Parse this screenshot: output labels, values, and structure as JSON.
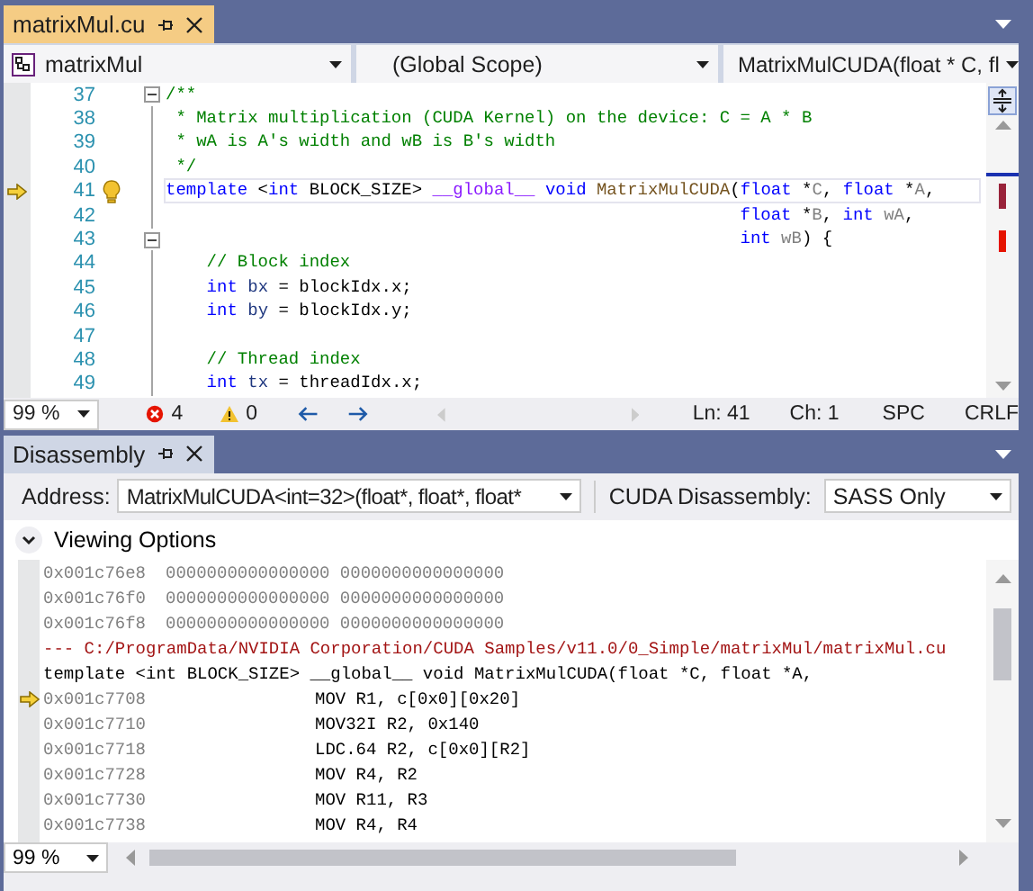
{
  "editor_tabs": [
    {
      "label": "matrixMul.cu",
      "selected": true
    }
  ],
  "navigation_bar": {
    "project": "matrixMul",
    "scope": "(Global Scope)",
    "member": "MatrixMulCUDA(float * C, fl"
  },
  "code_lines": [
    {
      "number": "37",
      "fold": true,
      "current": false,
      "lightbulb": false,
      "segments": [
        {
          "kind": "comment",
          "text": "/**"
        }
      ]
    },
    {
      "number": "38",
      "fold": false,
      "current": false,
      "lightbulb": false,
      "segments": [
        {
          "kind": "comment",
          "text": " * Matrix multiplication (CUDA Kernel) on the device: C = A * B"
        }
      ]
    },
    {
      "number": "39",
      "fold": false,
      "current": false,
      "lightbulb": false,
      "segments": [
        {
          "kind": "comment",
          "text": " * wA is A's width and wB is B's width"
        }
      ]
    },
    {
      "number": "40",
      "fold": false,
      "current": false,
      "lightbulb": false,
      "segments": [
        {
          "kind": "comment",
          "text": " */"
        }
      ]
    },
    {
      "number": "41",
      "fold": false,
      "current": true,
      "lightbulb": true,
      "segments": [
        {
          "kind": "keyword",
          "text": "template"
        },
        {
          "kind": "plain",
          "text": " <"
        },
        {
          "kind": "keyword",
          "text": "int"
        },
        {
          "kind": "plain",
          "text": " BLOCK_SIZE> "
        },
        {
          "kind": "macro",
          "text": "__global__"
        },
        {
          "kind": "keyword",
          "text": " void"
        },
        {
          "kind": "function",
          "text": " MatrixMulCUDA"
        },
        {
          "kind": "plain",
          "text": "("
        },
        {
          "kind": "keyword",
          "text": "float"
        },
        {
          "kind": "plain",
          "text": " *"
        },
        {
          "kind": "param",
          "text": "C"
        },
        {
          "kind": "plain",
          "text": ", "
        },
        {
          "kind": "keyword",
          "text": "float"
        },
        {
          "kind": "plain",
          "text": " *"
        },
        {
          "kind": "param",
          "text": "A"
        },
        {
          "kind": "plain",
          "text": ","
        }
      ]
    },
    {
      "number": "42",
      "fold": false,
      "current": false,
      "lightbulb": false,
      "segments": [
        {
          "kind": "keyword",
          "text": "                                                        float"
        },
        {
          "kind": "plain",
          "text": " *"
        },
        {
          "kind": "param",
          "text": "B"
        },
        {
          "kind": "plain",
          "text": ", "
        },
        {
          "kind": "keyword",
          "text": "int"
        },
        {
          "kind": "param",
          "text": " wA"
        },
        {
          "kind": "plain",
          "text": ","
        }
      ]
    },
    {
      "number": "43",
      "fold": true,
      "current": false,
      "lightbulb": false,
      "segments": [
        {
          "kind": "keyword",
          "text": "                                                        int"
        },
        {
          "kind": "param",
          "text": " wB"
        },
        {
          "kind": "plain",
          "text": ") {"
        }
      ]
    },
    {
      "number": "44",
      "fold": false,
      "current": false,
      "lightbulb": false,
      "segments": [
        {
          "kind": "comment",
          "text": "    // Block index"
        }
      ]
    },
    {
      "number": "45",
      "fold": false,
      "current": false,
      "lightbulb": false,
      "segments": [
        {
          "kind": "keyword",
          "text": "    int"
        },
        {
          "kind": "local",
          "text": " bx"
        },
        {
          "kind": "plain",
          "text": " = blockIdx.x;"
        }
      ]
    },
    {
      "number": "46",
      "fold": false,
      "current": false,
      "lightbulb": false,
      "segments": [
        {
          "kind": "keyword",
          "text": "    int"
        },
        {
          "kind": "local",
          "text": " by"
        },
        {
          "kind": "plain",
          "text": " = blockIdx.y;"
        }
      ]
    },
    {
      "number": "47",
      "fold": false,
      "current": false,
      "lightbulb": false
    },
    {
      "number": "48",
      "fold": false,
      "current": false,
      "lightbulb": false,
      "segments": [
        {
          "kind": "comment",
          "text": "    // Thread index"
        }
      ]
    },
    {
      "number": "49",
      "fold": false,
      "current": false,
      "lightbulb": false,
      "segments": [
        {
          "kind": "keyword",
          "text": "    int"
        },
        {
          "kind": "local",
          "text": " tx"
        },
        {
          "kind": "plain",
          "text": " = threadIdx.x;"
        }
      ]
    }
  ],
  "editor_status": {
    "zoom": "99 %",
    "errors": "4",
    "warnings": "0",
    "line": "Ln: 41",
    "column": "Ch: 1",
    "whitespace": "SPC",
    "line_endings": "CRLF"
  },
  "tool_tabs": [
    {
      "label": "Disassembly",
      "selected": false
    }
  ],
  "disassembly": {
    "address_label": "Address:",
    "address": "MatrixMulCUDA<int=32>(float*, float*, float*",
    "mode_label": "CUDA Disassembly:",
    "mode": "SASS Only",
    "viewing_options": "Viewing Options",
    "zoom": "99 %",
    "lines": [
      {
        "kind": "data",
        "current": false,
        "address": "0x001c76e8",
        "instruction": "0000000000000000 0000000000000000"
      },
      {
        "kind": "data",
        "current": false,
        "address": "0x001c76f0",
        "instruction": "0000000000000000 0000000000000000"
      },
      {
        "kind": "data",
        "current": false,
        "address": "0x001c76f8",
        "instruction": "0000000000000000 0000000000000000"
      },
      {
        "kind": "source",
        "current": false,
        "text": "--- C:/ProgramData/NVIDIA Corporation/CUDA Samples/v11.0/0_Simple/matrixMul/matrixMul.cu"
      },
      {
        "kind": "source_code",
        "current": false,
        "text": "template <int BLOCK_SIZE> __global__ void MatrixMulCUDA(float *C, float *A,"
      },
      {
        "kind": "code",
        "current": true,
        "address": "0x001c7708",
        "instruction": "MOV R1, c[0x0][0x20]"
      },
      {
        "kind": "code",
        "current": false,
        "address": "0x001c7710",
        "instruction": "MOV32I R2, 0x140"
      },
      {
        "kind": "code",
        "current": false,
        "address": "0x001c7718",
        "instruction": "LDC.64 R2, c[0x0][R2]"
      },
      {
        "kind": "code",
        "current": false,
        "address": "0x001c7728",
        "instruction": "MOV R4, R2"
      },
      {
        "kind": "code",
        "current": false,
        "address": "0x001c7730",
        "instruction": "MOV R11, R3"
      },
      {
        "kind": "code",
        "current": false,
        "address": "0x001c7738",
        "instruction": "MOV R4, R4"
      }
    ]
  }
}
